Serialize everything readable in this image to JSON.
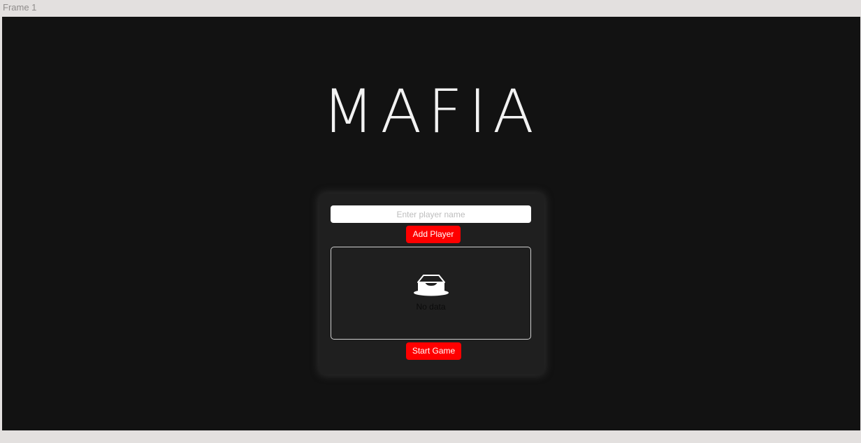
{
  "frame": {
    "label": "Frame 1"
  },
  "app": {
    "title": "MAFIA"
  },
  "form": {
    "name_placeholder": "Enter player name",
    "name_value": "",
    "add_label": "Add Player",
    "start_label": "Start Game"
  },
  "player_list": {
    "empty_icon": "empty-inbox-icon",
    "empty_text": "No data",
    "items": []
  },
  "colors": {
    "background": "#121212",
    "card": "#1f1f1f",
    "accent": "#ff0000",
    "title": "#f2f2f2"
  }
}
